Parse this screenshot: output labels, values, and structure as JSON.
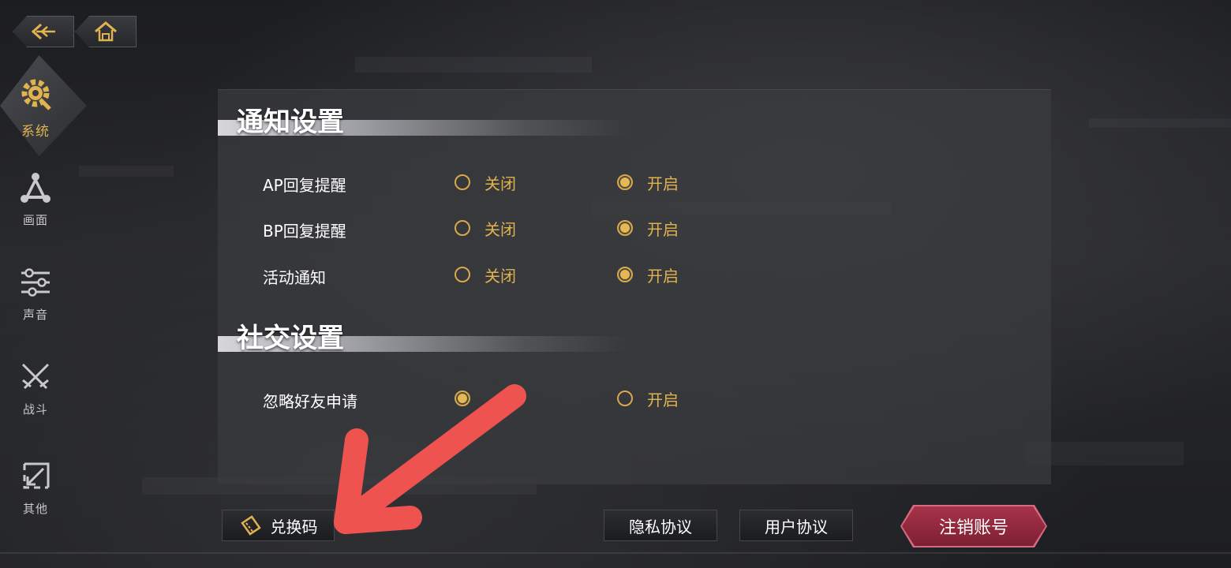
{
  "nav": {
    "back_icon": "back-arrow-icon",
    "home_icon": "home-icon"
  },
  "sidebar": {
    "items": [
      {
        "label": "系统",
        "icon": "gear-icon",
        "active": true
      },
      {
        "label": "画面",
        "icon": "triangle-nodes-icon",
        "active": false
      },
      {
        "label": "声音",
        "icon": "sliders-icon",
        "active": false
      },
      {
        "label": "战斗",
        "icon": "crossed-swords-icon",
        "active": false
      },
      {
        "label": "其他",
        "icon": "diagonal-arrow-icon",
        "active": false
      }
    ]
  },
  "sections": [
    {
      "title": "通知设置",
      "rows": [
        {
          "label": "AP回复提醒",
          "off_label": "关闭",
          "on_label": "开启",
          "selected": "on"
        },
        {
          "label": "BP回复提醒",
          "off_label": "关闭",
          "on_label": "开启",
          "selected": "on"
        },
        {
          "label": "活动通知",
          "off_label": "关闭",
          "on_label": "开启",
          "selected": "on"
        }
      ]
    },
    {
      "title": "社交设置",
      "rows": [
        {
          "label": "忽略好友申请",
          "off_label": "",
          "on_label": "开启",
          "selected": "off"
        }
      ]
    }
  ],
  "footer": {
    "redeem_label": "兑换码",
    "redeem_icon": "ticket-icon",
    "privacy_label": "隐私协议",
    "user_agreement_label": "用户协议",
    "cancel_account_label": "注销账号"
  },
  "colors": {
    "accent_gold": "#e0b34f",
    "danger_red": "#9a2c42",
    "annotation_arrow": "#ee5350"
  }
}
